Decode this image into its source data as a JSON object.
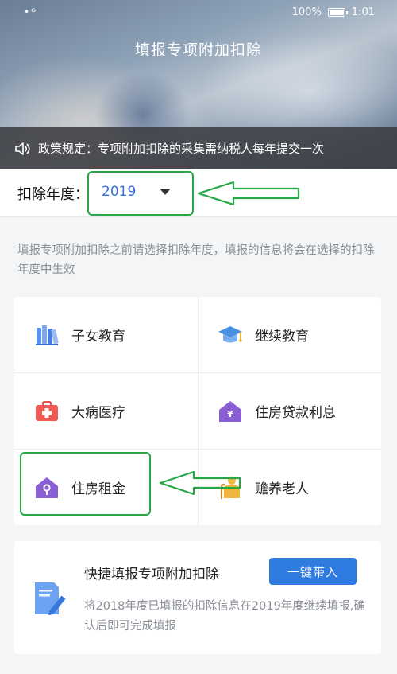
{
  "status_bar": {
    "left": "•ᴳ",
    "battery": "100%",
    "time": "1:01"
  },
  "app_title": "填报专项附加扣除",
  "policy": {
    "icon": "speaker-icon",
    "text": "政策规定：专项附加扣除的采集需纳税人每年提交一次"
  },
  "year_selector": {
    "label": "扣除年度：",
    "value": "2019",
    "icon": "caret-down-icon"
  },
  "hint": "填报专项附加扣除之前请选择扣除年度，填报的信息将会在选择的扣除年度中生效",
  "deductions": [
    {
      "label": "子女教育",
      "icon": "books-icon"
    },
    {
      "label": "继续教育",
      "icon": "graduation-cap-icon"
    },
    {
      "label": "大病医疗",
      "icon": "medical-kit-icon"
    },
    {
      "label": "住房贷款利息",
      "icon": "house-yen-icon"
    },
    {
      "label": "住房租金",
      "icon": "house-key-icon"
    },
    {
      "label": "赡养老人",
      "icon": "elderly-person-icon"
    }
  ],
  "quick_fill": {
    "icon": "document-pen-icon",
    "title": "快捷填报专项附加扣除",
    "button": "一键带入",
    "description": "将2018年度已填报的扣除信息在2019年度继续填报,确认后即可完成填报"
  },
  "colors": {
    "accent": "#2f7be0",
    "highlight": "#27a745",
    "year_value": "#3a6fd8"
  }
}
